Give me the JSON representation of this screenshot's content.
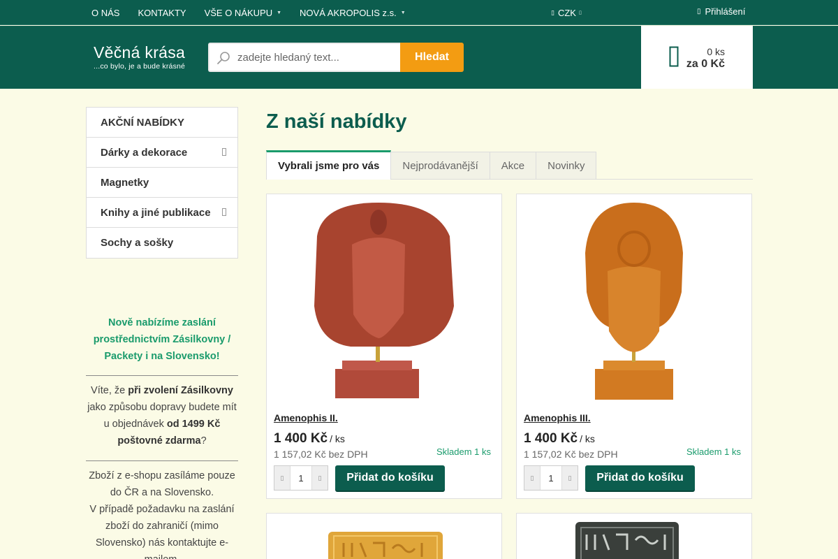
{
  "topnav": {
    "items": [
      {
        "label": "O NÁS",
        "caret": false
      },
      {
        "label": "KONTAKTY",
        "caret": false
      },
      {
        "label": "VŠE O NÁKUPU",
        "caret": true
      },
      {
        "label": "NOVÁ AKROPOLIS z.s.",
        "caret": true
      }
    ],
    "currency": "CZK",
    "login": "Přihlášení"
  },
  "header": {
    "logo_name": "Věčná krása",
    "logo_tagline": "...co bylo, je a bude krásné",
    "search_placeholder": "zadejte hledaný text...",
    "search_button": "Hledat",
    "cart_count": "0 ks",
    "cart_total": "za 0 Kč"
  },
  "sidebar": {
    "items": [
      {
        "label": "AKČNÍ NABÍDKY",
        "arrow": false
      },
      {
        "label": "Dárky a dekorace",
        "arrow": true
      },
      {
        "label": "Magnetky",
        "arrow": false
      },
      {
        "label": "Knihy a jiné publikace",
        "arrow": true
      },
      {
        "label": "Sochy a sošky",
        "arrow": false
      }
    ],
    "promo": "Nově nabízíme zaslání prostřednictvím Zásilkovny / Packety i na Slovensko!",
    "info1": {
      "p1": "Víte, že ",
      "b1": "při zvolení Zásilkovny",
      "p2": " jako způsobu dopravy budete mít u objednávek ",
      "b2": "od 1499 Kč poštovné zdarma",
      "p3": "?"
    },
    "info2a": "Zboží z e-shopu zasíláme pouze do ČR a na Slovensko.",
    "info2b": "V případě požadavku na zaslání zboží do zahraničí (mimo Slovensko) nás kontaktujte e-mailem."
  },
  "main": {
    "title": "Z naší nabídky",
    "tabs": [
      "Vybrali jsme pro vás",
      "Nejprodávanější",
      "Akce",
      "Novinky"
    ],
    "active_tab": 0,
    "products": [
      {
        "name": "Amenophis II.",
        "price": "1 400 Kč",
        "unit": "/ ks",
        "net": "1 157,02 Kč bez DPH",
        "stock": "Skladem 1 ks",
        "qty": "1",
        "add_label": "Přidat do košíku"
      },
      {
        "name": "Amenophis III.",
        "price": "1 400 Kč",
        "unit": "/ ks",
        "net": "1 157,02 Kč bez DPH",
        "stock": "Skladem 1 ks",
        "qty": "1",
        "add_label": "Přidat do košíku"
      }
    ]
  },
  "colors": {
    "brand_green": "#0c5d4e",
    "accent_green": "#1a9b6c",
    "search_orange": "#f39c12",
    "page_bg": "#fbfbe6"
  }
}
